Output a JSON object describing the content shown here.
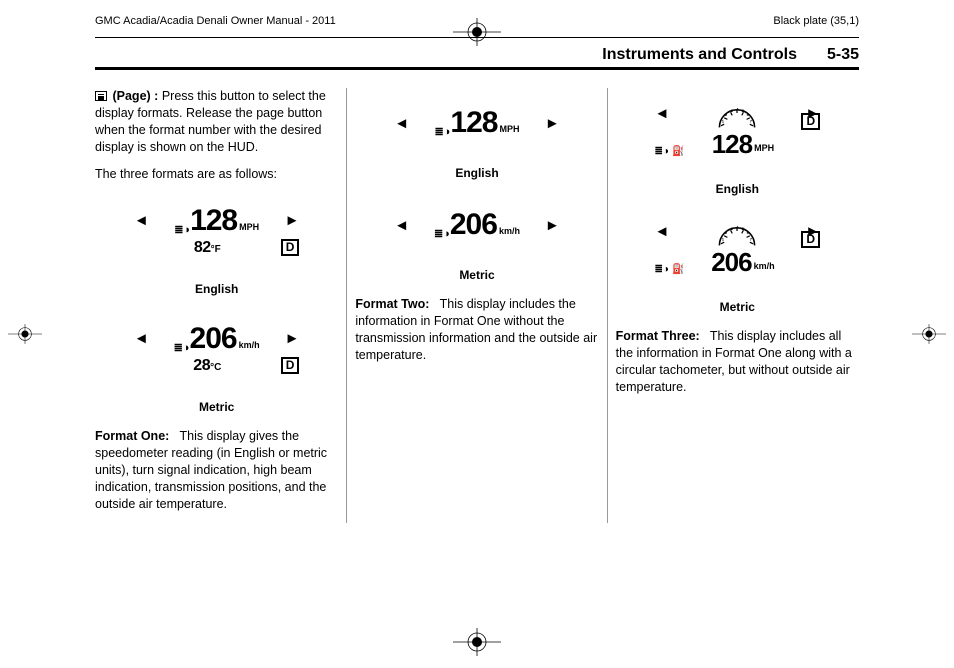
{
  "header": {
    "left": "GMC Acadia/Acadia Denali Owner Manual - 2011",
    "right": "Black plate (35,1)"
  },
  "section": {
    "title": "Instruments and Controls",
    "page": "5-35"
  },
  "col1": {
    "page_label": "(Page) :",
    "page_desc": "Press this button to select the display formats. Release the page button when the format number with the desired display is shown on the HUD.",
    "intro": "The three formats are as follows:",
    "fig_en": {
      "speed": "128",
      "unit": "MPH",
      "temp": "82",
      "deg": "°F",
      "gear": "D"
    },
    "cap_en": "English",
    "fig_me": {
      "speed": "206",
      "unit": "km/h",
      "temp": "28",
      "deg": "°C",
      "gear": "D"
    },
    "cap_me": "Metric",
    "f1_label": "Format One:",
    "f1_text": "This display gives the speedometer reading (in English or metric units), turn signal indication, high beam indication, transmission positions, and the outside air temperature."
  },
  "col2": {
    "fig_en": {
      "speed": "128",
      "unit": "MPH"
    },
    "cap_en": "English",
    "fig_me": {
      "speed": "206",
      "unit": "km/h"
    },
    "cap_me": "Metric",
    "f2_label": "Format Two:",
    "f2_text": "This display includes the information in Format One without the transmission information and the outside air temperature."
  },
  "col3": {
    "fig_en": {
      "speed": "128",
      "unit": "MPH",
      "gear": "D"
    },
    "cap_en": "English",
    "fig_me": {
      "speed": "206",
      "unit": "km/h",
      "gear": "D"
    },
    "cap_me": "Metric",
    "f3_label": "Format Three:",
    "f3_text": "This display includes all the information in Format One along with a circular tachometer, but without outside air temperature."
  }
}
